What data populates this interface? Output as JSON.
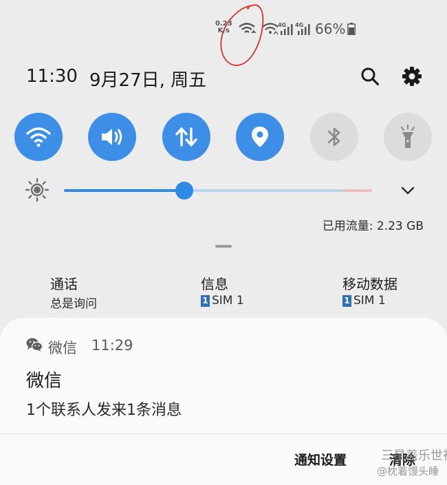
{
  "status_bar": {
    "network_speed_value": "0.23",
    "network_speed_unit": "K/s",
    "battery_percent": "66%",
    "signal_type_1": "4G",
    "signal_type_2": "4G"
  },
  "header": {
    "time": "11:30",
    "date": "9月27日, 周五"
  },
  "quick_settings": [
    {
      "icon": "wifi-icon",
      "active": true
    },
    {
      "icon": "sound-icon",
      "active": true
    },
    {
      "icon": "mobile-data-icon",
      "active": true
    },
    {
      "icon": "location-icon",
      "active": true
    },
    {
      "icon": "bluetooth-icon",
      "active": false
    },
    {
      "icon": "flashlight-icon",
      "active": false
    }
  ],
  "brightness": {
    "level": 0.39
  },
  "data_usage": {
    "label": "已用流量: 2.23 GB"
  },
  "sim_settings": [
    {
      "title": "通话",
      "value": "总是询问"
    },
    {
      "title": "信息",
      "sim_number": "1",
      "value": "SIM 1"
    },
    {
      "title": "移动数据",
      "sim_number": "1",
      "value": "SIM 1"
    }
  ],
  "notification": {
    "app_name": "微信",
    "time": "11:29",
    "title": "微信",
    "body": "1个联系人发来1条消息",
    "actions": {
      "settings": "通知设置",
      "clear": "清除"
    }
  },
  "watermark": {
    "line1": "三星盖乐世社区",
    "line2": "@枕着馒头睡"
  },
  "colors": {
    "accent": "#3d8ee6",
    "inactive": "#dcdcdc",
    "annotation": "#d8322e"
  }
}
